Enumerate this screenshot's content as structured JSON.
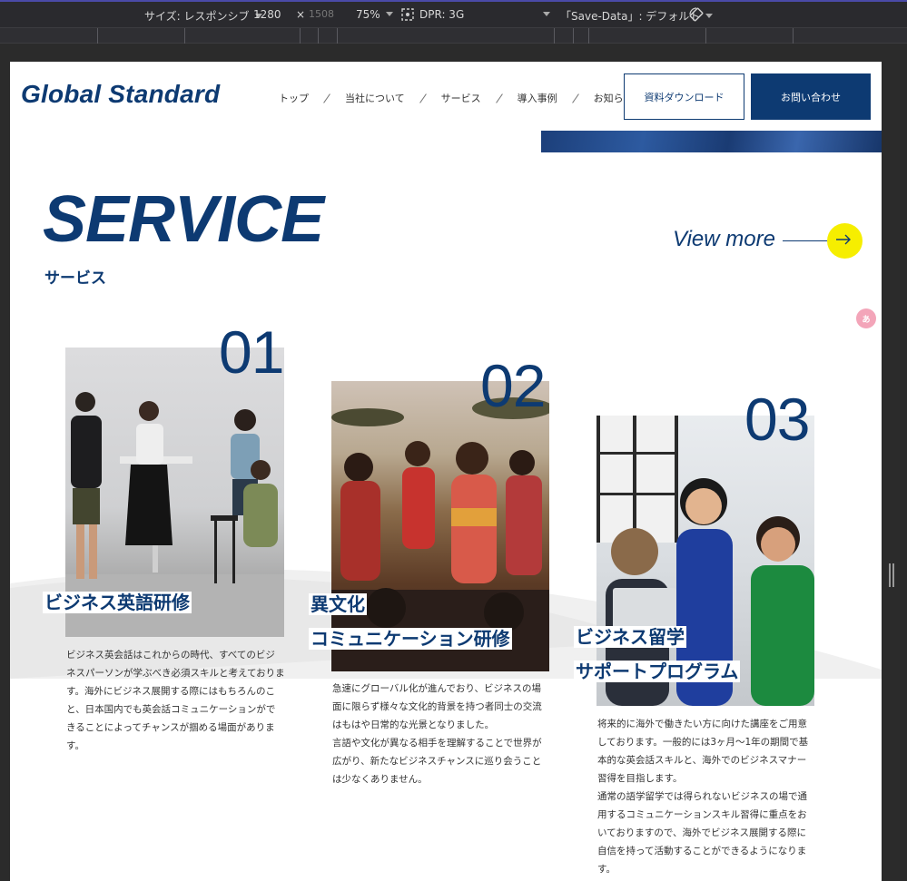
{
  "devtools": {
    "size_label": "サイズ: レスポンシブ",
    "width": "1280",
    "times": "×",
    "height": "1508",
    "zoom": "75%",
    "dpr_label": "DPR: 3G",
    "save_data": "「Save-Data」: デフォルト",
    "rotate_icon": "rotate-icon"
  },
  "header": {
    "logo": "Global Standard",
    "nav": [
      "トップ",
      "当社について",
      "サービス",
      "導入事例",
      "お知らせ"
    ],
    "download_button": "資料ダウンロード",
    "contact_button": "お問い合わせ"
  },
  "section": {
    "title": "SERVICE",
    "subtitle": "サービス",
    "view_more": "View more",
    "translate_icon": "translate-icon"
  },
  "cards": [
    {
      "number": "01",
      "title_lines": [
        "ビジネス英語研修"
      ],
      "body": [
        "ビジネス英会話はこれからの時代、すべてのビジ",
        "ネスパーソンが学ぶべき必須スキルと考えておりま",
        "す。海外にビジネス展開する際にはもちろんのこ",
        "と、日本国内でも英会話コミュニケーションがで",
        "きることによってチャンスが掴める場面がありま",
        "す。"
      ]
    },
    {
      "number": "02",
      "title_lines": [
        "異文化",
        "コミュニケーション研修"
      ],
      "body": [
        "急速にグローバル化が進んでおり、ビジネスの場",
        "面に限らず様々な文化的背景を持つ者同士の交流",
        "はもはや日常的な光景となりました。",
        "言語や文化が異なる相手を理解することで世界が",
        "広がり、新たなビジネスチャンスに巡り会うこと",
        "は少なくありません。"
      ]
    },
    {
      "number": "03",
      "title_lines": [
        "ビジネス留学",
        "サポートプログラム"
      ],
      "body": [
        "将来的に海外で働きたい方に向けた講座をご用意",
        "しております。一般的には3ヶ月〜1年の期間で基",
        "本的な英会話スキルと、海外でのビジネスマナー",
        "習得を目指します。",
        "通常の語学留学では得られないビジネスの場で通",
        "用するコミュニケーションスキル習得に重点をお",
        "いておりますので、海外でビジネス展開する際に",
        "自信を持って活動することができるようになりま",
        "す。"
      ]
    }
  ],
  "colors": {
    "brand_navy": "#0d3a72",
    "accent_yellow": "#f6ee00"
  }
}
